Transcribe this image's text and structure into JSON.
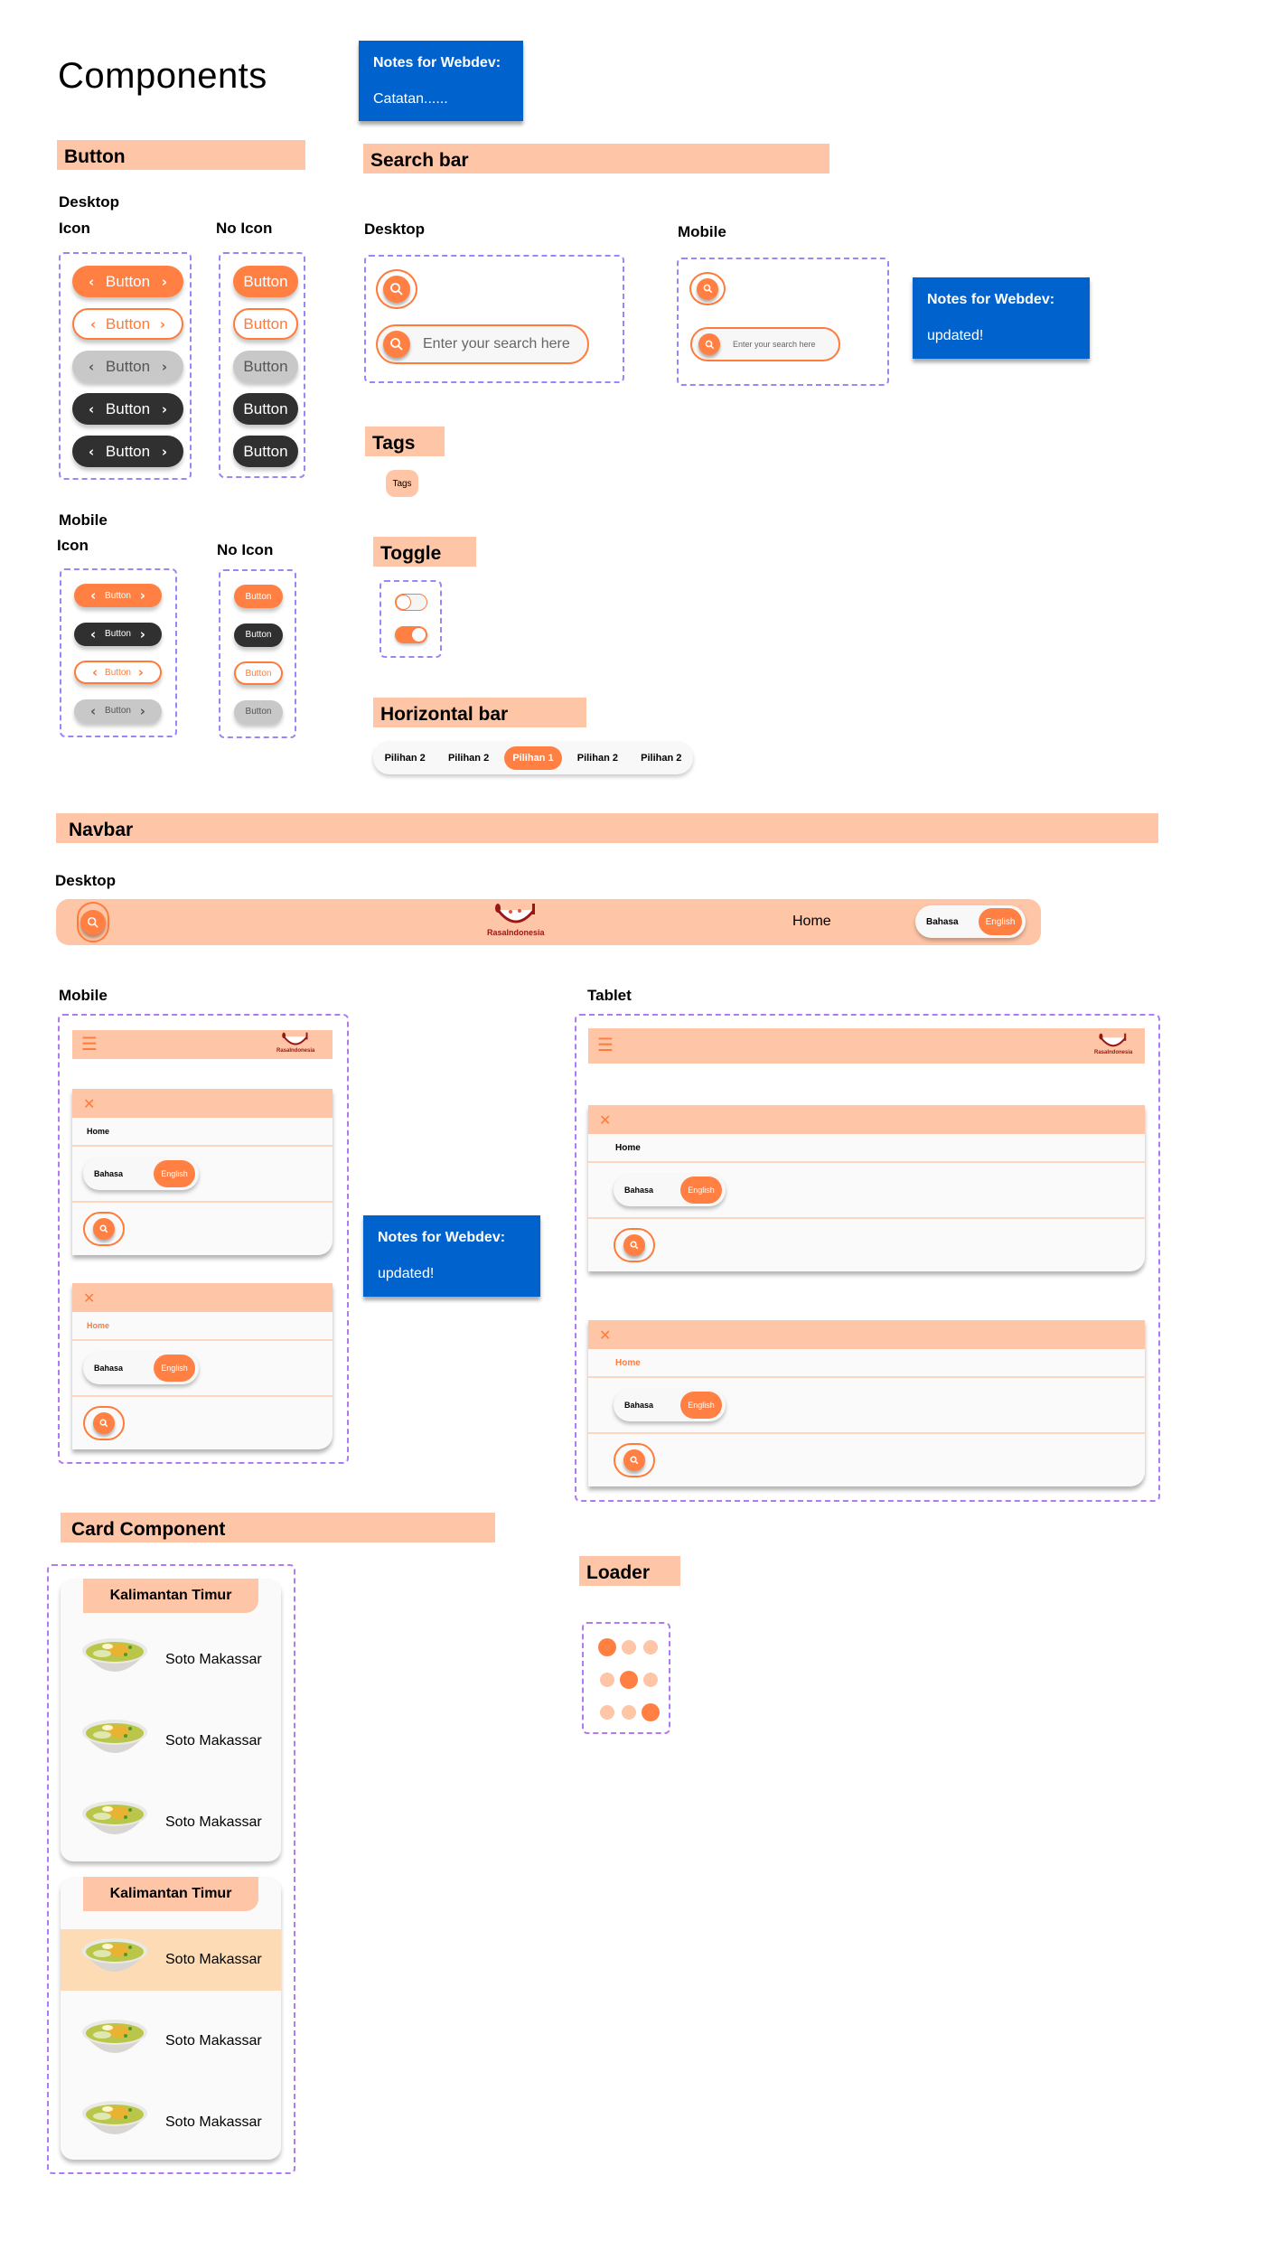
{
  "page_title": "Components",
  "notes": [
    {
      "heading": "Notes for Webdev:",
      "body": "Catatan......"
    },
    {
      "heading": "Notes for Webdev:",
      "body": "updated!"
    },
    {
      "heading": "Notes for Webdev:",
      "body": "updated!"
    }
  ],
  "colors": {
    "accent": "#ff8042",
    "section_bg": "#fec5a6",
    "note_bg": "#0062cc",
    "dark": "#303030",
    "disabled": "#c8c8c8",
    "highlight": "#fddcb5",
    "logo": "#9a1616"
  },
  "button_section": {
    "header": "Button",
    "desktop_label": "Desktop",
    "mobile_label": "Mobile",
    "icon_label": "Icon",
    "no_icon_label": "No Icon",
    "button_label": "Button",
    "desktop_icon_variants": [
      "primary",
      "outline",
      "disabled",
      "dark",
      "dark"
    ],
    "desktop_noicon_variants": [
      "primary",
      "outline",
      "disabled",
      "dark",
      "dark"
    ],
    "mobile_icon_variants": [
      "primary",
      "dark",
      "outline",
      "disabled"
    ],
    "mobile_noicon_variants": [
      "primary",
      "dark",
      "outline",
      "disabled"
    ],
    "chevron_left": "‹",
    "chevron_right": "›"
  },
  "search_section": {
    "header": "Search bar",
    "desktop_label": "Desktop",
    "mobile_label": "Mobile",
    "placeholder": "Enter your search here"
  },
  "tags_section": {
    "header": "Tags",
    "tag_label": "Tags"
  },
  "toggle_section": {
    "header": "Toggle",
    "states": [
      "off",
      "on"
    ]
  },
  "hbar_section": {
    "header": "Horizontal bar",
    "items": [
      {
        "label": "Pilihan 2",
        "active": false
      },
      {
        "label": "Pilihan 2",
        "active": false
      },
      {
        "label": "Pilihan 1",
        "active": true
      },
      {
        "label": "Pilihan 2",
        "active": false
      },
      {
        "label": "Pilihan 2",
        "active": false
      }
    ]
  },
  "navbar_section": {
    "header": "Navbar",
    "desktop_label": "Desktop",
    "mobile_label": "Mobile",
    "tablet_label": "Tablet",
    "logo_text": "RasaIndonesia",
    "home": "Home",
    "lang_bahasa": "Bahasa",
    "lang_english": "English",
    "close_glyph": "✕",
    "menu_glyph": "☰"
  },
  "card_section": {
    "header": "Card Component",
    "cards": [
      {
        "region": "Kalimantan Timur",
        "items": [
          {
            "name": "Soto Makassar",
            "highlighted": false
          },
          {
            "name": "Soto Makassar",
            "highlighted": false
          },
          {
            "name": "Soto Makassar",
            "highlighted": false
          }
        ]
      },
      {
        "region": "Kalimantan Timur",
        "items": [
          {
            "name": "Soto Makassar",
            "highlighted": true
          },
          {
            "name": "Soto Makassar",
            "highlighted": false
          },
          {
            "name": "Soto Makassar",
            "highlighted": false
          }
        ]
      }
    ]
  },
  "loader_section": {
    "header": "Loader",
    "active_dots": [
      [
        1,
        0,
        0
      ],
      [
        0,
        1,
        0
      ],
      [
        0,
        0,
        1
      ]
    ]
  }
}
